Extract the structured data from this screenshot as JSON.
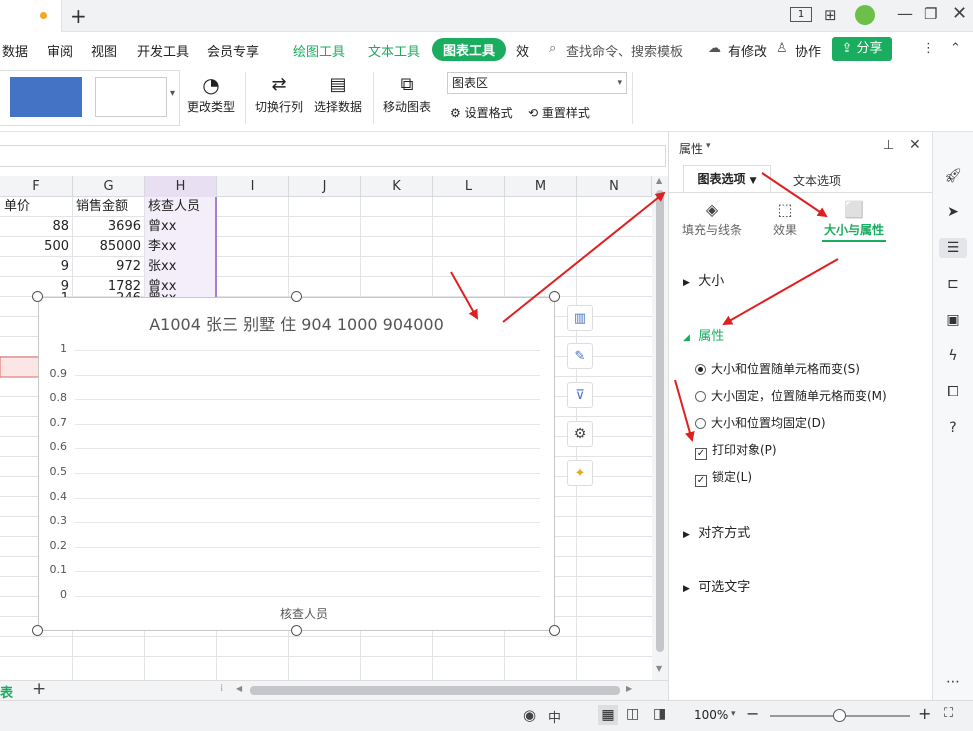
{
  "titlebar": {
    "new_tab_icon": "plus-icon"
  },
  "menu": {
    "items": [
      "数据",
      "审阅",
      "视图",
      "开发工具",
      "会员专享"
    ],
    "context_tabs": [
      "绘图工具",
      "文本工具"
    ],
    "active_tab": "图表工具",
    "truncated": "效",
    "search_placeholder": "查找命令、搜索模板",
    "modified": "有修改",
    "collaborate": "协作",
    "share": "分享"
  },
  "ribbon": {
    "change_type": "更改类型",
    "switch_rowcol": "切换行列",
    "select_data": "选择数据",
    "move_chart": "移动图表",
    "chart_area_select": "图表区",
    "set_format": "设置格式",
    "reset_style": "重置样式"
  },
  "sheet": {
    "columns": [
      "F",
      "G",
      "H",
      "I",
      "J",
      "K",
      "L",
      "M",
      "N"
    ],
    "header_row": [
      "单价",
      "销售金额",
      "核查人员"
    ],
    "rows": [
      [
        "88",
        "3696",
        "曾xx"
      ],
      [
        "500",
        "85000",
        "李xx"
      ],
      [
        "9",
        "972",
        "张xx"
      ],
      [
        "9",
        "1782",
        "曾xx"
      ],
      [
        "1",
        "246",
        "曾xx"
      ]
    ],
    "sheet_tab": "表"
  },
  "chart": {
    "title": "A1004 张三 别墅 住 904 1000 904000",
    "xlabel": "核查人员"
  },
  "chart_data": {
    "type": "bar",
    "title": "A1004 张三 别墅 住 904 1000 904000",
    "xlabel": "核查人员",
    "ylabel": "",
    "ylim": [
      0,
      1
    ],
    "yticks": [
      "1",
      "0.9",
      "0.8",
      "0.7",
      "0.6",
      "0.5",
      "0.4",
      "0.3",
      "0.2",
      "0.1",
      "0"
    ],
    "categories": [],
    "series": []
  },
  "panel": {
    "header": "属性",
    "tab_chart_options": "图表选项",
    "tab_text_options": "文本选项",
    "sub_fill": "填充与线条",
    "sub_effect": "效果",
    "sub_size": "大小与属性",
    "section_size": "大小",
    "section_props": "属性",
    "radio1": "大小和位置随单元格而变(S)",
    "radio2": "大小固定，位置随单元格而变(M)",
    "radio3": "大小和位置均固定(D)",
    "check_print": "打印对象(P)",
    "check_lock": "锁定(L)",
    "section_align": "对齐方式",
    "section_alt": "可选文字",
    "accent": "#1aad5f"
  },
  "status": {
    "zoom": "100%"
  }
}
